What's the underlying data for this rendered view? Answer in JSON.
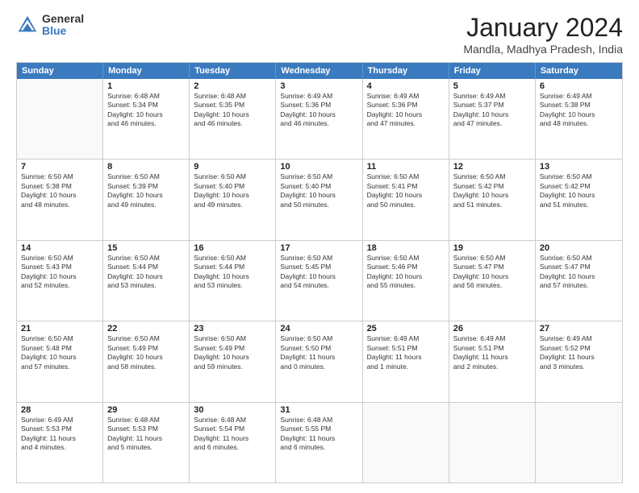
{
  "logo": {
    "general": "General",
    "blue": "Blue"
  },
  "title": "January 2024",
  "location": "Mandla, Madhya Pradesh, India",
  "days_of_week": [
    "Sunday",
    "Monday",
    "Tuesday",
    "Wednesday",
    "Thursday",
    "Friday",
    "Saturday"
  ],
  "rows": [
    [
      {
        "day": "",
        "lines": []
      },
      {
        "day": "1",
        "lines": [
          "Sunrise: 6:48 AM",
          "Sunset: 5:34 PM",
          "Daylight: 10 hours",
          "and 46 minutes."
        ]
      },
      {
        "day": "2",
        "lines": [
          "Sunrise: 6:48 AM",
          "Sunset: 5:35 PM",
          "Daylight: 10 hours",
          "and 46 minutes."
        ]
      },
      {
        "day": "3",
        "lines": [
          "Sunrise: 6:49 AM",
          "Sunset: 5:36 PM",
          "Daylight: 10 hours",
          "and 46 minutes."
        ]
      },
      {
        "day": "4",
        "lines": [
          "Sunrise: 6:49 AM",
          "Sunset: 5:36 PM",
          "Daylight: 10 hours",
          "and 47 minutes."
        ]
      },
      {
        "day": "5",
        "lines": [
          "Sunrise: 6:49 AM",
          "Sunset: 5:37 PM",
          "Daylight: 10 hours",
          "and 47 minutes."
        ]
      },
      {
        "day": "6",
        "lines": [
          "Sunrise: 6:49 AM",
          "Sunset: 5:38 PM",
          "Daylight: 10 hours",
          "and 48 minutes."
        ]
      }
    ],
    [
      {
        "day": "7",
        "lines": [
          "Sunrise: 6:50 AM",
          "Sunset: 5:38 PM",
          "Daylight: 10 hours",
          "and 48 minutes."
        ]
      },
      {
        "day": "8",
        "lines": [
          "Sunrise: 6:50 AM",
          "Sunset: 5:39 PM",
          "Daylight: 10 hours",
          "and 49 minutes."
        ]
      },
      {
        "day": "9",
        "lines": [
          "Sunrise: 6:50 AM",
          "Sunset: 5:40 PM",
          "Daylight: 10 hours",
          "and 49 minutes."
        ]
      },
      {
        "day": "10",
        "lines": [
          "Sunrise: 6:50 AM",
          "Sunset: 5:40 PM",
          "Daylight: 10 hours",
          "and 50 minutes."
        ]
      },
      {
        "day": "11",
        "lines": [
          "Sunrise: 6:50 AM",
          "Sunset: 5:41 PM",
          "Daylight: 10 hours",
          "and 50 minutes."
        ]
      },
      {
        "day": "12",
        "lines": [
          "Sunrise: 6:50 AM",
          "Sunset: 5:42 PM",
          "Daylight: 10 hours",
          "and 51 minutes."
        ]
      },
      {
        "day": "13",
        "lines": [
          "Sunrise: 6:50 AM",
          "Sunset: 5:42 PM",
          "Daylight: 10 hours",
          "and 51 minutes."
        ]
      }
    ],
    [
      {
        "day": "14",
        "lines": [
          "Sunrise: 6:50 AM",
          "Sunset: 5:43 PM",
          "Daylight: 10 hours",
          "and 52 minutes."
        ]
      },
      {
        "day": "15",
        "lines": [
          "Sunrise: 6:50 AM",
          "Sunset: 5:44 PM",
          "Daylight: 10 hours",
          "and 53 minutes."
        ]
      },
      {
        "day": "16",
        "lines": [
          "Sunrise: 6:50 AM",
          "Sunset: 5:44 PM",
          "Daylight: 10 hours",
          "and 53 minutes."
        ]
      },
      {
        "day": "17",
        "lines": [
          "Sunrise: 6:50 AM",
          "Sunset: 5:45 PM",
          "Daylight: 10 hours",
          "and 54 minutes."
        ]
      },
      {
        "day": "18",
        "lines": [
          "Sunrise: 6:50 AM",
          "Sunset: 5:46 PM",
          "Daylight: 10 hours",
          "and 55 minutes."
        ]
      },
      {
        "day": "19",
        "lines": [
          "Sunrise: 6:50 AM",
          "Sunset: 5:47 PM",
          "Daylight: 10 hours",
          "and 56 minutes."
        ]
      },
      {
        "day": "20",
        "lines": [
          "Sunrise: 6:50 AM",
          "Sunset: 5:47 PM",
          "Daylight: 10 hours",
          "and 57 minutes."
        ]
      }
    ],
    [
      {
        "day": "21",
        "lines": [
          "Sunrise: 6:50 AM",
          "Sunset: 5:48 PM",
          "Daylight: 10 hours",
          "and 57 minutes."
        ]
      },
      {
        "day": "22",
        "lines": [
          "Sunrise: 6:50 AM",
          "Sunset: 5:49 PM",
          "Daylight: 10 hours",
          "and 58 minutes."
        ]
      },
      {
        "day": "23",
        "lines": [
          "Sunrise: 6:50 AM",
          "Sunset: 5:49 PM",
          "Daylight: 10 hours",
          "and 59 minutes."
        ]
      },
      {
        "day": "24",
        "lines": [
          "Sunrise: 6:50 AM",
          "Sunset: 5:50 PM",
          "Daylight: 11 hours",
          "and 0 minutes."
        ]
      },
      {
        "day": "25",
        "lines": [
          "Sunrise: 6:49 AM",
          "Sunset: 5:51 PM",
          "Daylight: 11 hours",
          "and 1 minute."
        ]
      },
      {
        "day": "26",
        "lines": [
          "Sunrise: 6:49 AM",
          "Sunset: 5:51 PM",
          "Daylight: 11 hours",
          "and 2 minutes."
        ]
      },
      {
        "day": "27",
        "lines": [
          "Sunrise: 6:49 AM",
          "Sunset: 5:52 PM",
          "Daylight: 11 hours",
          "and 3 minutes."
        ]
      }
    ],
    [
      {
        "day": "28",
        "lines": [
          "Sunrise: 6:49 AM",
          "Sunset: 5:53 PM",
          "Daylight: 11 hours",
          "and 4 minutes."
        ]
      },
      {
        "day": "29",
        "lines": [
          "Sunrise: 6:48 AM",
          "Sunset: 5:53 PM",
          "Daylight: 11 hours",
          "and 5 minutes."
        ]
      },
      {
        "day": "30",
        "lines": [
          "Sunrise: 6:48 AM",
          "Sunset: 5:54 PM",
          "Daylight: 11 hours",
          "and 6 minutes."
        ]
      },
      {
        "day": "31",
        "lines": [
          "Sunrise: 6:48 AM",
          "Sunset: 5:55 PM",
          "Daylight: 11 hours",
          "and 6 minutes."
        ]
      },
      {
        "day": "",
        "lines": []
      },
      {
        "day": "",
        "lines": []
      },
      {
        "day": "",
        "lines": []
      }
    ]
  ]
}
